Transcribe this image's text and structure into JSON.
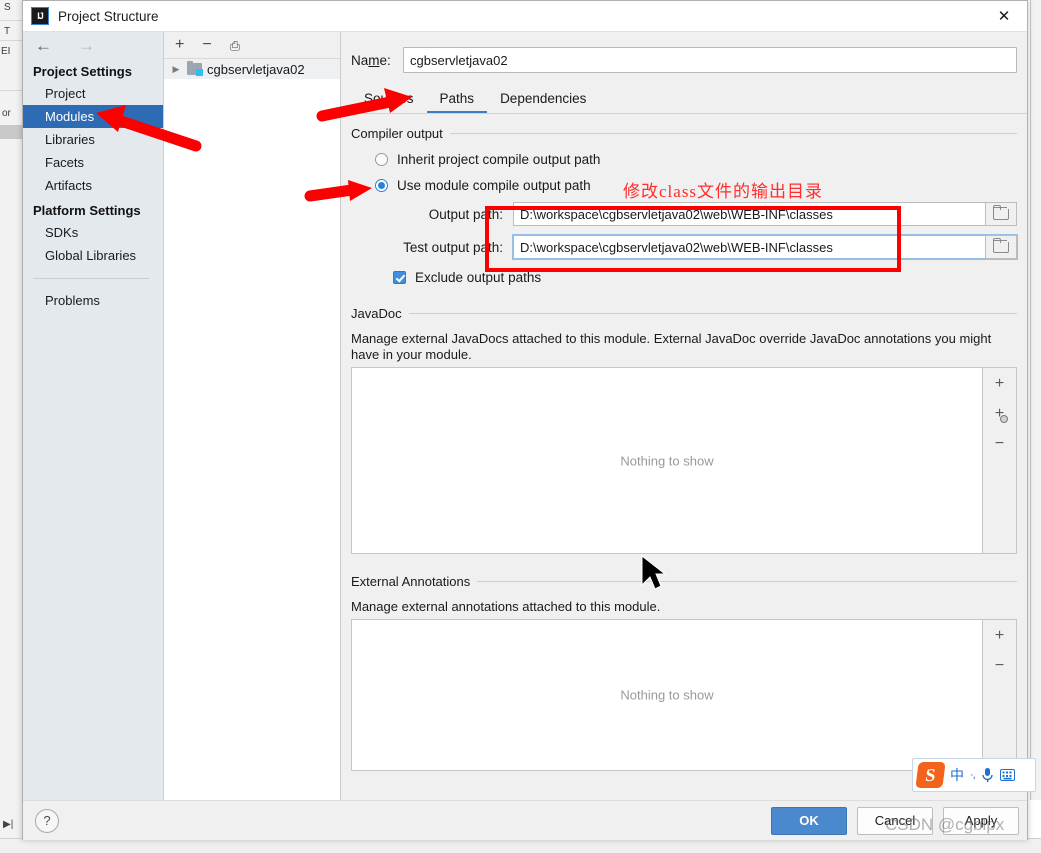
{
  "window": {
    "title": "Project Structure",
    "icon": "intellij-idea-icon",
    "close_label": "✕"
  },
  "nav": {
    "back": "←",
    "forward": "→"
  },
  "sidebar": {
    "sections": [
      {
        "heading": "Project Settings",
        "items": [
          {
            "label": "Project",
            "selected": false
          },
          {
            "label": "Modules",
            "selected": true
          },
          {
            "label": "Libraries",
            "selected": false
          },
          {
            "label": "Facets",
            "selected": false
          },
          {
            "label": "Artifacts",
            "selected": false
          }
        ]
      },
      {
        "heading": "Platform Settings",
        "items": [
          {
            "label": "SDKs",
            "selected": false
          },
          {
            "label": "Global Libraries",
            "selected": false
          }
        ]
      }
    ],
    "problems_label": "Problems"
  },
  "module_list": {
    "toolbar": {
      "add": "+",
      "remove": "−",
      "copy": "⎙"
    },
    "tree": [
      {
        "label": "cgbservletjava02",
        "expand_glyph": "▶",
        "icon": "module-folder-icon"
      }
    ]
  },
  "name_field": {
    "label_pre": "Na",
    "label_mnemonic": "m",
    "label_post": "e:",
    "value": "cgbservletjava02",
    "placeholder": ""
  },
  "tabs": [
    {
      "label": "Sources",
      "active": false
    },
    {
      "label": "Paths",
      "active": true
    },
    {
      "label": "Dependencies",
      "active": false
    }
  ],
  "compiler_output": {
    "group_title": "Compiler output",
    "radio_inherit": "Inherit project compile output path",
    "radio_module": "Use module compile output path",
    "selected_radio": "module",
    "output_path": {
      "label": "Output path:",
      "value": "D:\\workspace\\cgbservletjava02\\web\\WEB-INF\\classes",
      "placeholder": "",
      "browse_icon": "folder-browse-icon"
    },
    "test_output_path": {
      "label": "Test output path:",
      "value": "D:\\workspace\\cgbservletjava02\\web\\WEB-INF\\classes",
      "placeholder": "",
      "browse_icon": "folder-browse-icon",
      "focused": true
    },
    "exclude_checkbox": {
      "label": "Exclude output paths",
      "checked": true
    }
  },
  "javadoc": {
    "group_title": "JavaDoc",
    "description": "Manage external JavaDocs attached to this module. External JavaDoc override JavaDoc annotations you might have in your module.",
    "empty_text": "Nothing to show",
    "buttons": [
      {
        "icon": "plus-icon",
        "glyph": "+"
      },
      {
        "icon": "plus-with-circle-icon",
        "glyph": "+"
      },
      {
        "icon": "minus-icon",
        "glyph": "−"
      }
    ]
  },
  "external_annotations": {
    "group_title": "External Annotations",
    "description": "Manage external annotations attached to this module.",
    "empty_text": "Nothing to show",
    "buttons": [
      {
        "icon": "plus-icon",
        "glyph": "+"
      },
      {
        "icon": "minus-icon",
        "glyph": "−"
      }
    ]
  },
  "footer": {
    "help_label": "?",
    "ok_label": "OK",
    "cancel_label": "Cancel",
    "apply_label": "Apply"
  },
  "annotations": {
    "red_note": "修改class文件的输出目录",
    "red_color": "#fa0000",
    "arrows": [
      {
        "name": "arrow-to-modules"
      },
      {
        "name": "arrow-to-paths-tab"
      },
      {
        "name": "arrow-to-use-module-radio"
      }
    ]
  },
  "ime_bar": {
    "logo": "S",
    "mode_label": "中",
    "punct_label": "·,",
    "mic_icon": "microphone-icon",
    "keyboard_icon": "keyboard-icon"
  },
  "watermark": {
    "text": "CSDN @cgblpx"
  },
  "background": {
    "left_fragments": [
      "S",
      "T",
      "EI",
      "or"
    ]
  }
}
